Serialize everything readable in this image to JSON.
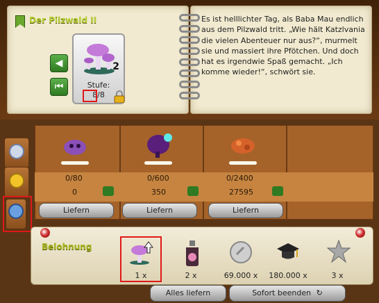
{
  "quest": {
    "title": "Der Pilzwald II",
    "item_count": "2",
    "stufe_label": "Stufe:",
    "stufe_current": "8",
    "stufe_sep": "/",
    "stufe_max": "8",
    "story": "Es ist helllichter Tag, als Baba Mau endlich aus dem Pilzwald tritt. „Wie hält Katzlvania die vielen Abenteuer nur aus?“, murmelt sie und massiert ihre Pfötchen. Und doch hat es irgendwie Spaß gemacht. „Ich komme wieder!“, schwört sie."
  },
  "deliveries": [
    {
      "icon": "purple-blob-icon",
      "progress": "0/80",
      "have": "0",
      "button": "Liefern"
    },
    {
      "icon": "purple-tree-icon",
      "progress": "0/600",
      "have": "350",
      "button": "Liefern"
    },
    {
      "icon": "orange-rock-icon",
      "progress": "0/2400",
      "have": "27595",
      "button": "Liefern"
    }
  ],
  "reward": {
    "label": "Belohnung",
    "items": [
      {
        "icon": "mushroom-upgrade-icon",
        "qty": "1 x"
      },
      {
        "icon": "potion-bottle-icon",
        "qty": "2 x"
      },
      {
        "icon": "silver-coin-icon",
        "qty": "69.000 x"
      },
      {
        "icon": "graduation-cap-icon",
        "qty": "180.000 x"
      },
      {
        "icon": "star-icon",
        "qty": "3 x"
      }
    ]
  },
  "buttons": {
    "deliver_all": "Alles liefern",
    "finish_now": "Sofort beenden"
  },
  "colors": {
    "highlight": "#e01818",
    "title_green": "#b9d13a",
    "panel_brown": "#a5632a"
  }
}
